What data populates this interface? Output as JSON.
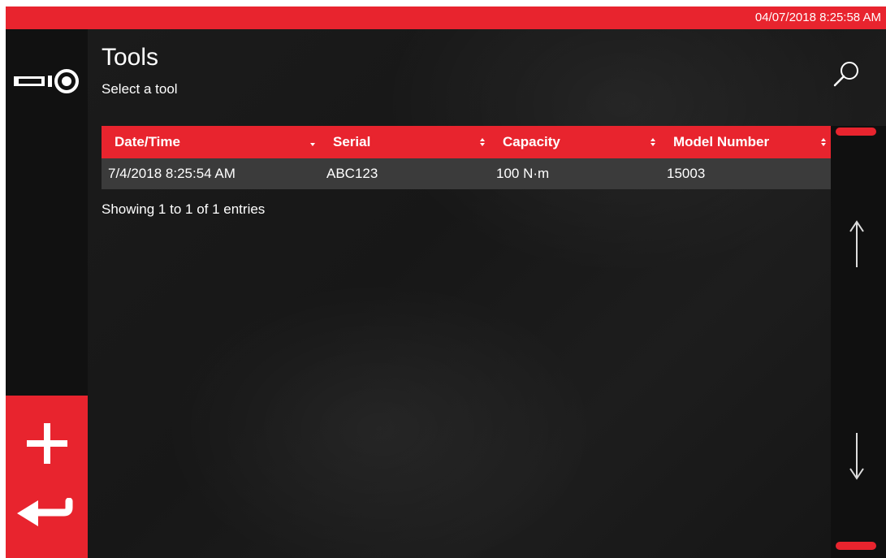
{
  "status_bar": {
    "datetime": "04/07/2018 8:25:58 AM"
  },
  "header": {
    "title": "Tools",
    "subtitle": "Select a tool"
  },
  "icons": {
    "tool": "tool-icon",
    "search": "search-icon",
    "add": "plus-icon",
    "back": "return-arrow-icon",
    "scroll_up": "arrow-up-icon",
    "scroll_down": "arrow-down-icon"
  },
  "table": {
    "columns": [
      "Date/Time",
      "Serial",
      "Capacity",
      "Model Number"
    ],
    "rows": [
      {
        "datetime": "7/4/2018 8:25:54 AM",
        "serial": "ABC123",
        "capacity": "100 N·m",
        "model": "15003"
      }
    ],
    "info": "Showing 1 to 1 of 1 entries"
  },
  "colors": {
    "accent": "#e8242e",
    "row_bg": "#3b3b3b",
    "background": "#1a1a1a",
    "sidebar": "#111111"
  }
}
